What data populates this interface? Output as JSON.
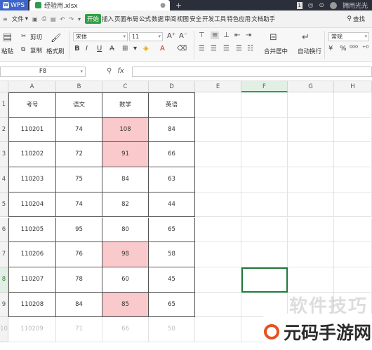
{
  "titlebar": {
    "app": "WPS",
    "file_tab": "经验用.xlsx",
    "new_tab": "+",
    "page_indicator": "1",
    "user": "拥用光光"
  },
  "menu": {
    "file": "文件",
    "items": [
      "开始",
      "插入",
      "页面布局",
      "公式",
      "数据",
      "审阅",
      "视图",
      "安全",
      "开发工具",
      "特色应用",
      "文档助手"
    ],
    "active_index": 0,
    "search": "查找"
  },
  "ribbon": {
    "paste": "粘贴",
    "cut": "剪切",
    "copy": "复制",
    "format_painter": "格式刷",
    "font_name": "宋体",
    "font_size": "11",
    "merge_center": "合并居中",
    "auto_wrap": "自动换行",
    "number_format": "常规",
    "bold": "B",
    "italic": "I",
    "underline": "U"
  },
  "formula_bar": {
    "name_box": "F8",
    "fx": "fx",
    "zoom_icon": "magnifier-icon"
  },
  "grid": {
    "columns": [
      "A",
      "B",
      "C",
      "D",
      "E",
      "F",
      "G",
      "H"
    ],
    "selected_column": "F",
    "selected_row": "8",
    "rows": [
      "1",
      "2",
      "3",
      "4",
      "5",
      "6",
      "7",
      "8",
      "9",
      "10"
    ],
    "headers": [
      "考号",
      "语文",
      "数学",
      "英语"
    ],
    "data": [
      {
        "id": "110201",
        "chinese": "74",
        "math": "108",
        "english": "84",
        "highlight": true
      },
      {
        "id": "110202",
        "chinese": "72",
        "math": "91",
        "english": "66",
        "highlight": true
      },
      {
        "id": "110203",
        "chinese": "75",
        "math": "84",
        "english": "63",
        "highlight": false
      },
      {
        "id": "110204",
        "chinese": "74",
        "math": "82",
        "english": "44",
        "highlight": false
      },
      {
        "id": "110205",
        "chinese": "95",
        "math": "80",
        "english": "65",
        "highlight": false
      },
      {
        "id": "110206",
        "chinese": "76",
        "math": "98",
        "english": "58",
        "highlight": true
      },
      {
        "id": "110207",
        "chinese": "78",
        "math": "60",
        "english": "45",
        "highlight": false
      },
      {
        "id": "110208",
        "chinese": "84",
        "math": "85",
        "english": "65",
        "highlight": true
      },
      {
        "id": "110209",
        "chinese": "71",
        "math": "66",
        "english": "50",
        "highlight": false
      }
    ],
    "highlight_color": "#f9c9cc",
    "active_border_color": "#1e7b3a"
  },
  "watermark": {
    "text": "软件技巧",
    "brand": "元码手游网"
  }
}
